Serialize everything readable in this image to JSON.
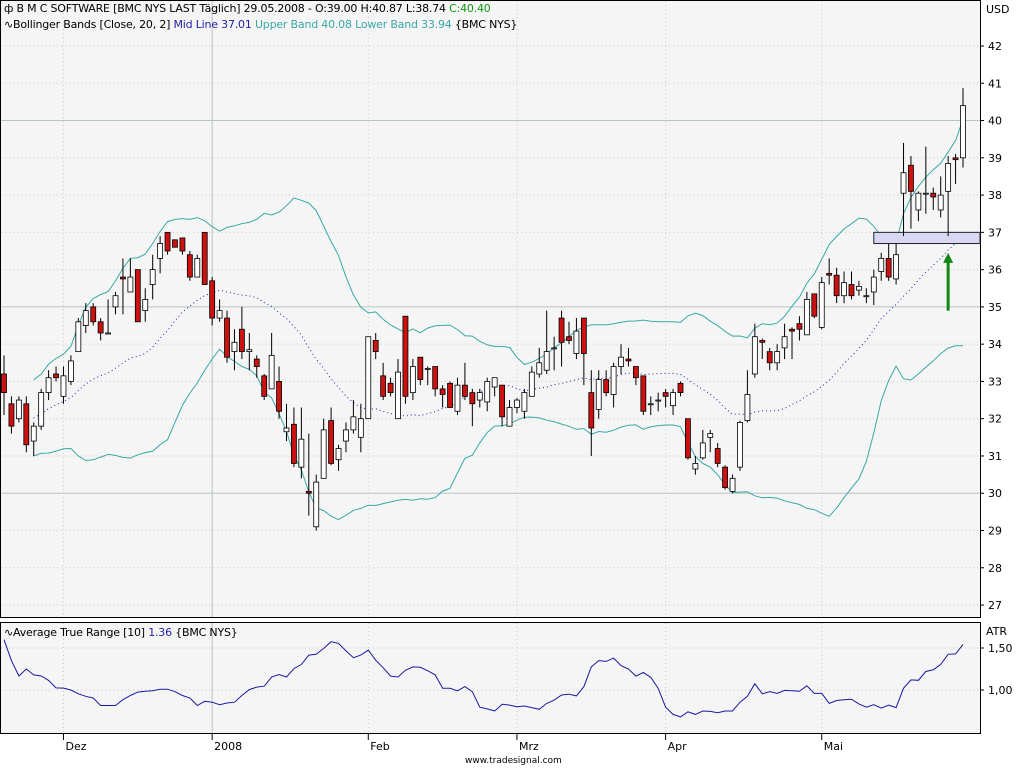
{
  "header": {
    "instrument_icon": "candlestick-icon",
    "instrument": "B M C SOFTWARE [BMC NYS LAST Täglich] 29.05.2008 - O:39.00 H:40.87 L:38.74",
    "close": "C:40.40",
    "indicator_icon": "wave-icon",
    "bb_label": "Bollinger Bands [Close, 20, 2]",
    "mid": "Mid Line 37.01",
    "upper_lower": "Upper Band 40.08 Lower Band 33.94",
    "bb_symbol": "{BMC NYS}",
    "atr_label": "Average True Range [10]",
    "atr_value": "1.36",
    "atr_symbol": "{BMC NYS}"
  },
  "colors": {
    "up": "#ffffff",
    "down": "#cc1111",
    "mid": "#2222bb",
    "band": "#3aa8a8",
    "atr": "#1a1aa0",
    "close": "#119911",
    "box": "#d8d8f4",
    "arrow": "#118811"
  },
  "footer": "www.tradesignal.com",
  "chart_data": [
    {
      "type": "candlestick",
      "title": "B M C SOFTWARE [BMC NYS LAST Täglich]",
      "yunit": "USD",
      "ylim": [
        27,
        42
      ],
      "yticks": [
        "27",
        "28",
        "29",
        "30",
        "31",
        "32",
        "33",
        "34",
        "35",
        "36",
        "37",
        "38",
        "39",
        "40",
        "41",
        "42"
      ],
      "xticks": [
        {
          "label": "Dez",
          "index": 8
        },
        {
          "label": "2008",
          "index": 28
        },
        {
          "label": "Feb",
          "index": 49
        },
        {
          "label": "Mrz",
          "index": 69
        },
        {
          "label": "Apr",
          "index": 89
        },
        {
          "label": "Mai",
          "index": 110
        }
      ],
      "ohlc": [
        [
          33.2,
          33.7,
          32.1,
          32.7
        ],
        [
          32.4,
          32.6,
          31.6,
          31.8
        ],
        [
          32.0,
          32.6,
          31.9,
          32.5
        ],
        [
          32.4,
          32.6,
          31.1,
          31.3
        ],
        [
          31.4,
          31.9,
          31.0,
          31.8
        ],
        [
          31.8,
          32.8,
          31.7,
          32.7
        ],
        [
          32.7,
          33.3,
          32.5,
          33.1
        ],
        [
          33.2,
          33.4,
          33.0,
          33.1
        ],
        [
          32.6,
          33.4,
          32.4,
          33.15
        ],
        [
          33.0,
          33.7,
          32.9,
          33.55
        ],
        [
          33.8,
          34.7,
          33.8,
          34.6
        ],
        [
          34.5,
          35.1,
          34.3,
          34.9
        ],
        [
          35.0,
          35.1,
          34.5,
          34.6
        ],
        [
          34.6,
          34.7,
          34.1,
          34.3
        ],
        [
          34.3,
          35.2,
          34.3,
          34.3
        ],
        [
          35.0,
          35.4,
          34.8,
          35.3
        ],
        [
          35.8,
          36.3,
          34.8,
          35.75
        ],
        [
          35.4,
          36.3,
          35.4,
          35.8
        ],
        [
          36.0,
          36.0,
          34.6,
          34.6
        ],
        [
          34.9,
          35.5,
          34.6,
          35.2
        ],
        [
          35.6,
          36.4,
          35.2,
          36.0
        ],
        [
          36.3,
          36.9,
          35.9,
          36.7
        ],
        [
          37.0,
          37.0,
          36.4,
          36.5
        ],
        [
          36.8,
          36.8,
          36.6,
          36.6
        ],
        [
          36.85,
          36.85,
          36.4,
          36.5
        ],
        [
          36.4,
          36.5,
          35.7,
          35.8
        ],
        [
          35.8,
          36.4,
          35.8,
          36.3
        ],
        [
          37.0,
          37.0,
          35.6,
          35.6
        ],
        [
          35.7,
          35.8,
          34.5,
          34.7
        ],
        [
          34.7,
          35.2,
          34.6,
          34.9
        ],
        [
          34.7,
          34.9,
          33.5,
          33.65
        ],
        [
          33.8,
          34.4,
          33.3,
          34.05
        ],
        [
          34.4,
          35.0,
          33.6,
          33.8
        ],
        [
          33.8,
          34.3,
          33.3,
          33.85
        ],
        [
          33.6,
          33.7,
          33.1,
          33.4
        ],
        [
          33.15,
          33.2,
          32.5,
          32.6
        ],
        [
          32.8,
          34.3,
          32.8,
          33.7
        ],
        [
          33.0,
          33.4,
          32.0,
          32.2
        ],
        [
          31.65,
          32.4,
          31.4,
          31.75
        ],
        [
          31.85,
          32.3,
          30.7,
          30.8
        ],
        [
          30.7,
          32.3,
          30.4,
          31.45
        ],
        [
          30.05,
          31.6,
          29.4,
          30.0
        ],
        [
          29.1,
          30.5,
          29.0,
          30.3
        ],
        [
          30.4,
          32.0,
          30.4,
          31.7
        ],
        [
          31.95,
          32.3,
          30.75,
          30.8
        ],
        [
          30.9,
          31.3,
          30.6,
          31.2
        ],
        [
          31.4,
          31.9,
          31.1,
          31.7
        ],
        [
          31.7,
          32.5,
          31.6,
          32.05
        ],
        [
          31.5,
          32.4,
          31.1,
          32.0
        ],
        [
          32.0,
          34.2,
          32.0,
          34.2
        ],
        [
          34.1,
          34.3,
          33.6,
          33.8
        ],
        [
          33.15,
          33.5,
          32.5,
          32.6
        ],
        [
          32.95,
          33.1,
          32.6,
          32.7
        ],
        [
          32.0,
          33.6,
          32.0,
          33.25
        ],
        [
          34.75,
          34.75,
          32.4,
          32.6
        ],
        [
          32.7,
          33.6,
          32.5,
          33.4
        ],
        [
          33.65,
          33.65,
          32.9,
          33.05
        ],
        [
          33.35,
          33.4,
          32.9,
          33.35
        ],
        [
          33.4,
          33.4,
          32.6,
          32.8
        ],
        [
          32.8,
          32.9,
          32.3,
          32.65
        ],
        [
          32.95,
          33.0,
          32.3,
          32.3
        ],
        [
          32.2,
          33.1,
          32.1,
          32.9
        ],
        [
          32.9,
          33.5,
          32.5,
          32.6
        ],
        [
          32.7,
          32.8,
          31.8,
          32.4
        ],
        [
          32.5,
          32.8,
          32.3,
          32.7
        ],
        [
          32.45,
          33.1,
          32.2,
          33.0
        ],
        [
          32.85,
          33.1,
          32.6,
          33.1
        ],
        [
          32.9,
          32.9,
          31.8,
          32.05
        ],
        [
          31.8,
          32.5,
          31.8,
          32.3
        ],
        [
          32.3,
          32.55,
          32.15,
          32.5
        ],
        [
          32.2,
          32.8,
          32.0,
          32.7
        ],
        [
          32.6,
          33.4,
          32.6,
          33.25
        ],
        [
          33.2,
          33.9,
          33.1,
          33.5
        ],
        [
          33.3,
          34.9,
          33.2,
          33.8
        ],
        [
          33.9,
          34.2,
          33.3,
          33.9
        ],
        [
          34.7,
          34.9,
          33.4,
          34.05
        ],
        [
          34.2,
          34.6,
          34.0,
          34.1
        ],
        [
          33.75,
          34.7,
          33.6,
          34.35
        ],
        [
          34.7,
          34.7,
          32.9,
          33.75
        ],
        [
          32.7,
          33.3,
          31.0,
          31.75
        ],
        [
          32.25,
          33.3,
          32.0,
          33.05
        ],
        [
          33.05,
          33.3,
          32.6,
          32.7
        ],
        [
          32.65,
          33.5,
          32.3,
          33.4
        ],
        [
          33.4,
          34.0,
          33.2,
          33.65
        ],
        [
          33.6,
          33.9,
          33.4,
          33.55
        ],
        [
          33.4,
          33.4,
          32.9,
          33.1
        ],
        [
          33.15,
          33.15,
          32.1,
          32.2
        ],
        [
          32.4,
          32.6,
          32.1,
          32.4
        ],
        [
          32.5,
          32.7,
          32.2,
          32.5
        ],
        [
          32.7,
          32.8,
          32.3,
          32.6
        ],
        [
          32.35,
          32.8,
          32.1,
          32.7
        ],
        [
          32.95,
          33.0,
          32.6,
          32.7
        ],
        [
          32.0,
          32.0,
          30.9,
          30.95
        ],
        [
          30.65,
          31.0,
          30.5,
          30.8
        ],
        [
          30.95,
          31.7,
          30.9,
          31.35
        ],
        [
          31.5,
          31.7,
          31.1,
          31.6
        ],
        [
          31.2,
          31.35,
          30.7,
          30.8
        ],
        [
          30.7,
          30.75,
          30.1,
          30.15
        ],
        [
          30.05,
          30.5,
          30.0,
          30.4
        ],
        [
          30.7,
          31.95,
          30.6,
          31.9
        ],
        [
          31.95,
          33.3,
          31.9,
          32.65
        ],
        [
          33.2,
          34.55,
          33.1,
          34.2
        ],
        [
          34.1,
          34.15,
          33.6,
          34.05
        ],
        [
          33.8,
          33.9,
          33.3,
          33.5
        ],
        [
          33.5,
          34.0,
          33.3,
          33.8
        ],
        [
          33.9,
          34.55,
          33.6,
          34.2
        ],
        [
          34.4,
          34.45,
          33.6,
          34.35
        ],
        [
          34.55,
          34.75,
          34.1,
          34.4
        ],
        [
          34.25,
          35.4,
          34.25,
          35.2
        ],
        [
          35.35,
          35.35,
          34.7,
          34.75
        ],
        [
          34.45,
          35.8,
          34.4,
          35.65
        ],
        [
          35.9,
          36.3,
          35.6,
          35.85
        ],
        [
          35.85,
          36.05,
          35.1,
          35.3
        ],
        [
          35.3,
          35.95,
          35.1,
          35.65
        ],
        [
          35.6,
          35.95,
          35.2,
          35.3
        ],
        [
          35.45,
          35.7,
          35.3,
          35.55
        ],
        [
          35.3,
          35.5,
          35.1,
          35.3
        ],
        [
          35.4,
          36.0,
          35.05,
          35.8
        ],
        [
          35.95,
          36.45,
          35.7,
          36.3
        ],
        [
          36.3,
          36.7,
          35.7,
          35.8
        ],
        [
          35.75,
          36.7,
          35.6,
          36.4
        ],
        [
          38.05,
          39.4,
          36.9,
          38.6
        ],
        [
          38.8,
          39.05,
          37.1,
          38.1
        ],
        [
          37.6,
          38.1,
          37.3,
          38.05
        ],
        [
          38.05,
          39.3,
          37.5,
          38.05
        ],
        [
          38.05,
          38.2,
          37.6,
          37.95
        ],
        [
          37.6,
          38.5,
          37.4,
          38.0
        ],
        [
          38.1,
          39.05,
          36.9,
          38.85
        ],
        [
          39.0,
          39.1,
          38.3,
          38.95
        ],
        [
          39.0,
          40.87,
          38.74,
          40.4
        ]
      ],
      "bollinger": {
        "period": 20,
        "stddev": 2
      },
      "annotation_zone": {
        "from": 36.7,
        "to": 37.0,
        "start_index": 117
      },
      "annotation_arrow": {
        "index": 127,
        "from": 34.9,
        "to": 36.45
      }
    },
    {
      "type": "line",
      "title": "Average True Range [10]",
      "ylabel": "ATR",
      "yticks": [
        "1,00",
        "1,50"
      ],
      "ytick_values": [
        1.0,
        1.5
      ],
      "period": 10
    }
  ]
}
